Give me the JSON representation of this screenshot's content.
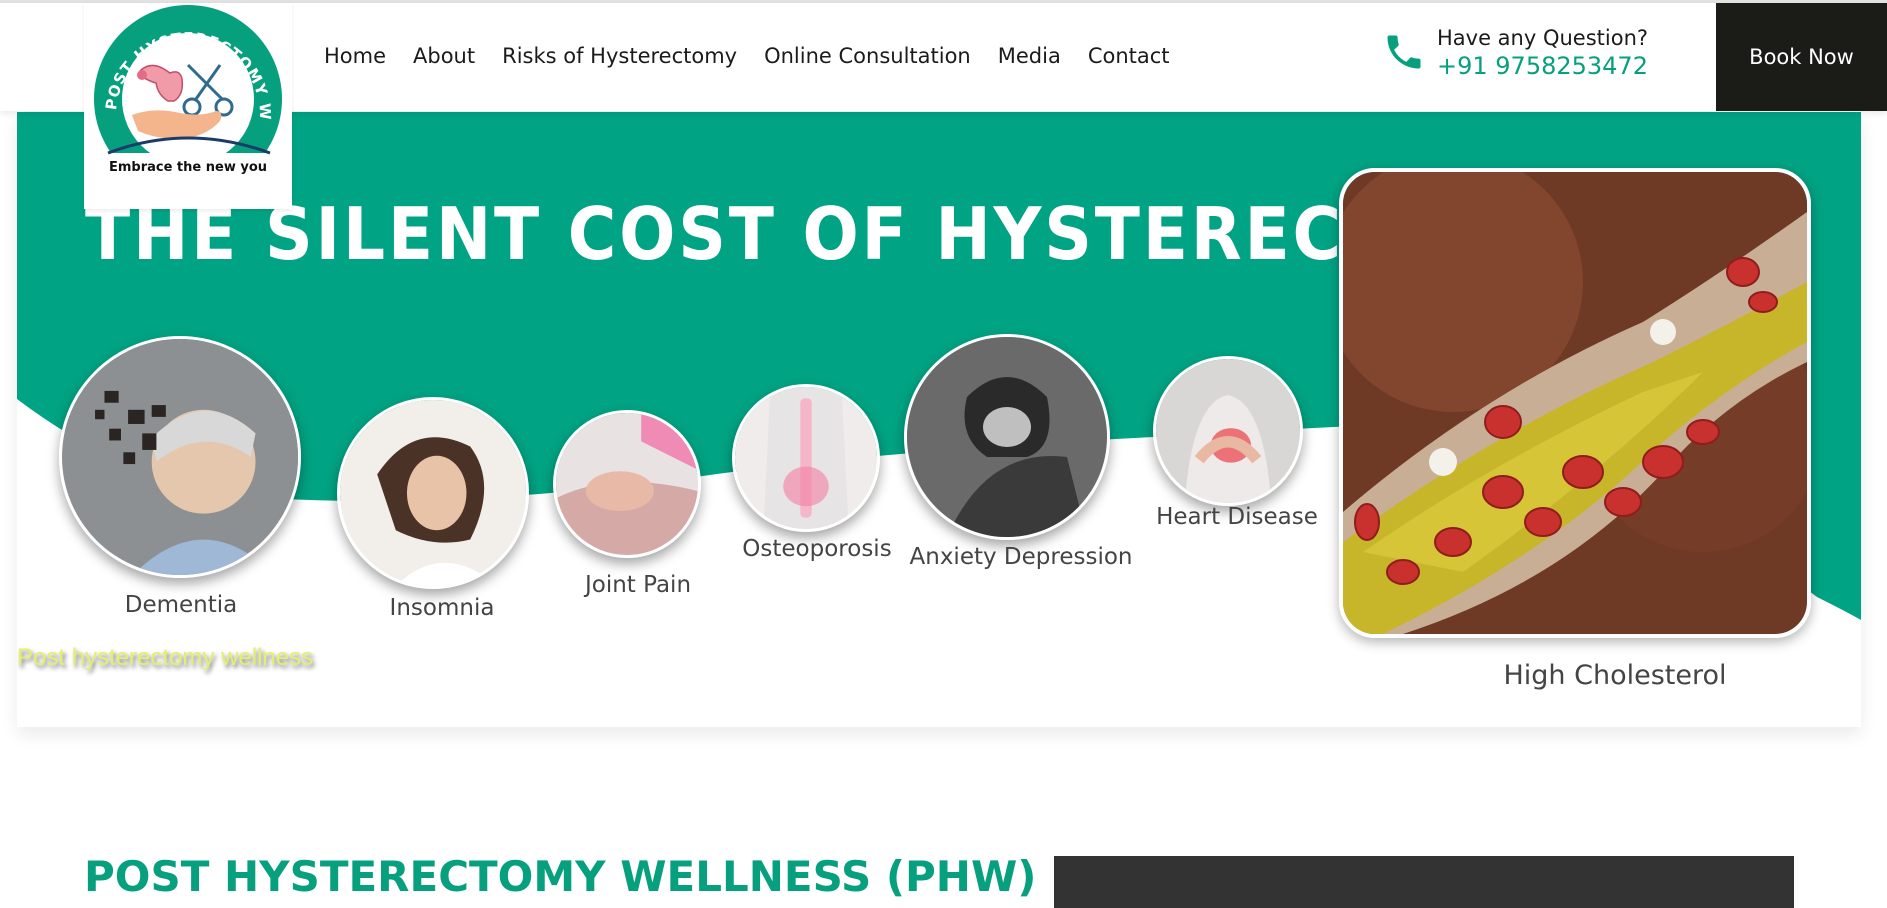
{
  "logo": {
    "ring_text": "POST HYSTERECTOMY WELLNESS",
    "tagline": "Embrace the new you"
  },
  "nav": {
    "items": [
      "Home",
      "About",
      "Risks of Hysterectomy",
      "Online Consultation",
      "Media",
      "Contact"
    ]
  },
  "contact": {
    "question": "Have any Question?",
    "phone": "+91 9758253472"
  },
  "book_button": "Book Now",
  "banner": {
    "headline": "THE SILENT COST OF HYSTERECTOMY",
    "conditions": [
      "Dementia",
      "Insomnia",
      "Joint Pain",
      "Osteoporosis",
      "Anxiety Depression",
      "Heart Disease"
    ],
    "feature_label": "High Cholesterol",
    "watermark": "Post hysterectomy wellness"
  },
  "section": {
    "title": "POST HYSTERECTOMY WELLNESS (PHW)"
  },
  "colors": {
    "brand_green": "#06a07e",
    "dark": "#1b1b18",
    "watermark": "#e5ef6f"
  },
  "icons": [
    "phone-icon",
    "uterus-icon",
    "scissors-icon",
    "hand-icon"
  ]
}
